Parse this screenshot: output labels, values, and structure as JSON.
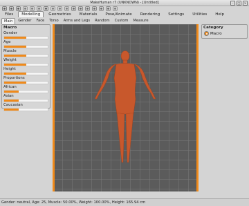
{
  "window": {
    "title": "MakeHuman r7 (UNKNOWN) - [Untitled]"
  },
  "toolbar": {
    "icons": [
      "undo-icon",
      "redo-icon",
      "reset-icon",
      "save-icon",
      "load-icon",
      "export-icon",
      "smooth-icon",
      "wireframe-icon",
      "background-icon",
      "pose-icon",
      "front-view-icon",
      "back-view-icon",
      "left-view-icon",
      "right-view-icon",
      "top-view-icon",
      "bottom-view-icon",
      "reset-camera-icon"
    ]
  },
  "menu": {
    "tabs": [
      {
        "label": "Files",
        "active": false
      },
      {
        "label": "Modelling",
        "active": true
      },
      {
        "label": "Geometries",
        "active": false
      },
      {
        "label": "Materials",
        "active": false
      },
      {
        "label": "Pose/Animate",
        "active": false
      },
      {
        "label": "Rendering",
        "active": false
      },
      {
        "label": "Settings",
        "active": false
      },
      {
        "label": "Utilities",
        "active": false
      },
      {
        "label": "Help",
        "active": false
      }
    ]
  },
  "submenu": {
    "tabs": [
      {
        "label": "Main",
        "active": true
      },
      {
        "label": "Gender",
        "active": false
      },
      {
        "label": "Face",
        "active": false
      },
      {
        "label": "Torso",
        "active": false
      },
      {
        "label": "Arms and Legs",
        "active": false
      },
      {
        "label": "Random",
        "active": false
      },
      {
        "label": "Custom",
        "active": false
      },
      {
        "label": "Measure",
        "active": false
      }
    ]
  },
  "left_panel": {
    "title": "Macro",
    "sliders": [
      {
        "label": "Gender",
        "value": 0.5
      },
      {
        "label": "Age",
        "value": 0.5
      },
      {
        "label": "Muscle",
        "value": 0.5
      },
      {
        "label": "Weight",
        "value": 0.5
      },
      {
        "label": "Height",
        "value": 0.5
      },
      {
        "label": "Proportions",
        "value": 0.5
      },
      {
        "label": "African",
        "value": 0.33
      },
      {
        "label": "Asian",
        "value": 0.33
      },
      {
        "label": "Caucasian",
        "value": 0.33
      }
    ]
  },
  "right_panel": {
    "title": "Category",
    "option_label": "Macro"
  },
  "status": {
    "text": "Gender: neutral, Age: 25, Muscle: 50.00%, Weight: 100.00%, Height: 165.94 cm"
  },
  "colors": {
    "accent": "#f08a1a",
    "skin": "#c8582c"
  }
}
